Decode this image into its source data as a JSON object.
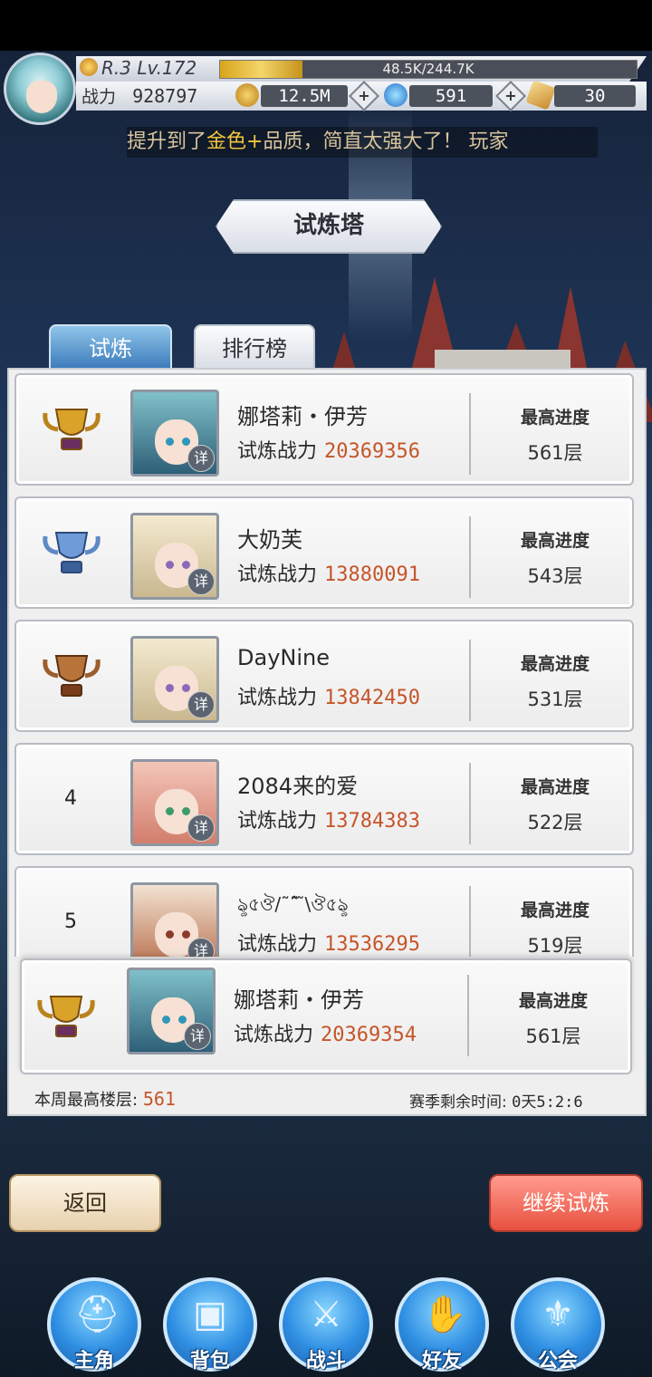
{
  "player": {
    "rank_level": "R.3 Lv.172",
    "exp_text": "48.5K/244.7K",
    "exp_fraction": 0.198,
    "power_label": "战力",
    "power_value": "928797"
  },
  "resources": {
    "gold": "12.5M",
    "gems": "591",
    "tickets": "30"
  },
  "marquee": {
    "before": "提升到了",
    "highlight": "金色+",
    "after": "品质，简直太强大了！   玩家"
  },
  "screen_title": "试炼塔",
  "tabs": [
    {
      "label": "试炼"
    },
    {
      "label": "排行榜"
    }
  ],
  "labels": {
    "power_label": "试炼战力",
    "best_label": "最高进度",
    "detail": "详"
  },
  "leaderboard": [
    {
      "rank": "1",
      "trophy": "gold",
      "name": "娜塔莉・伊芳",
      "power": "20369356",
      "best": "561层"
    },
    {
      "rank": "2",
      "trophy": "silver",
      "name": "大奶芙",
      "power": "13880091",
      "best": "543层"
    },
    {
      "rank": "3",
      "trophy": "bronze",
      "name": "DayNine",
      "power": "13842450",
      "best": "531层"
    },
    {
      "rank": "4",
      "trophy": "",
      "name": "2084来的爱",
      "power": "13784383",
      "best": "522层"
    },
    {
      "rank": "5",
      "trophy": "",
      "name": "ৡ৫ঔ/˜ˆ̃ ̃\\ঔ৫ৡ",
      "power": "13536295",
      "best": "519层"
    }
  ],
  "my_entry": {
    "trophy": "gold",
    "name": "娜塔莉・伊芳",
    "power": "20369354",
    "best": "561层"
  },
  "footer": {
    "weekly_label": "本周最高楼层:",
    "weekly_value": "561",
    "season_label": "赛季剩余时间:",
    "season_value": "0天5:2:6"
  },
  "buttons": {
    "back": "返回",
    "continue": "继续试炼"
  },
  "nav": [
    {
      "label": "主角",
      "icon": "helmet-icon"
    },
    {
      "label": "背包",
      "icon": "backpack-icon"
    },
    {
      "label": "战斗",
      "icon": "crossed-swords-icon"
    },
    {
      "label": "好友",
      "icon": "handshake-icon"
    },
    {
      "label": "公会",
      "icon": "guild-crest-icon"
    }
  ],
  "colors": {
    "gold_trophy": "#d9a228",
    "silver_trophy": "#6f9bd8",
    "bronze_trophy": "#b8733a",
    "power_value": "#c6552a",
    "continue_button": "#e9503f",
    "nav_blue": "#2f8fe3"
  }
}
